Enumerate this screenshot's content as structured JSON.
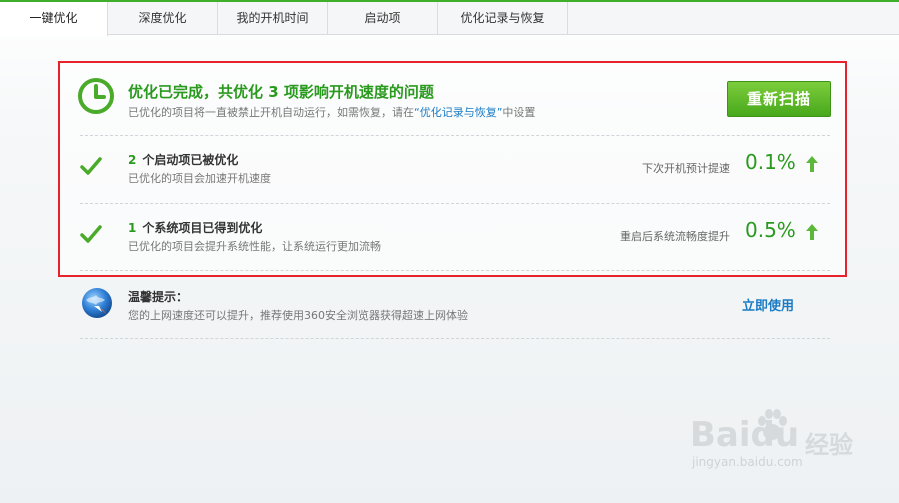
{
  "tabs": [
    "一键优化",
    "深度优化",
    "我的开机时间",
    "启动项",
    "优化记录与恢复"
  ],
  "summary": {
    "title": "优化已完成，共优化 3 项影响开机速度的问题",
    "desc_prefix": "已优化的项目将一直被禁止开机自动运行，如需恢复，请在",
    "desc_link": "“优化记录与恢复”",
    "desc_suffix": "中设置",
    "rescan_label": "重新扫描"
  },
  "rows": [
    {
      "num": "2",
      "title": "个启动项已被优化",
      "desc": "已优化的项目会加速开机速度",
      "metric_label": "下次开机预计提速",
      "metric_value": "0.1%"
    },
    {
      "num": "1",
      "title": "个系统项目已得到优化",
      "desc": "已优化的项目会提升系统性能，让系统运行更加流畅",
      "metric_label": "重启后系统流畅度提升",
      "metric_value": "0.5%"
    }
  ],
  "tip": {
    "title": "温馨提示：",
    "desc": "您的上网速度还可以提升，推荐使用360安全浏览器获得超速上网体验",
    "link": "立即使用"
  },
  "watermark": {
    "logo": "Bai",
    "logo_tail": "du",
    "jingyan": "经验",
    "url": "jingyan.baidu.com"
  },
  "colors": {
    "accent": "#2a9a1f",
    "highlight_border": "#e8222a",
    "link": "#1a7bc4"
  }
}
